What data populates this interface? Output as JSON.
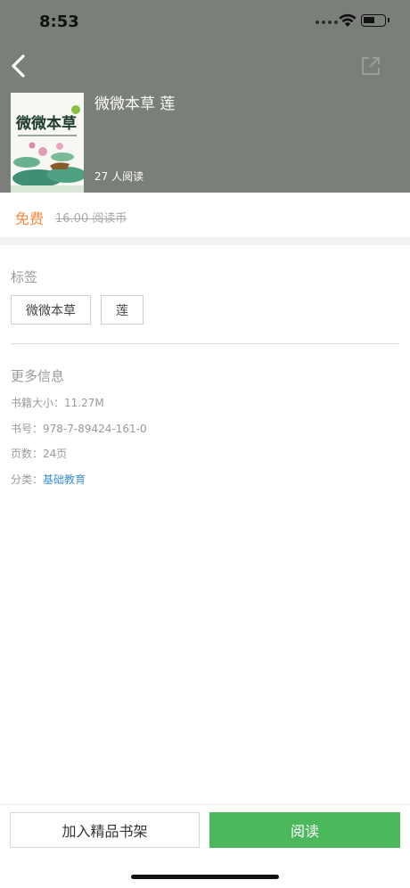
{
  "status_bar": {
    "time": "8:53"
  },
  "book": {
    "title": "微微本草 莲",
    "readers": "27 人阅读",
    "cover_title": "微微本草"
  },
  "price": {
    "free_label": "免费",
    "original": "16.00 阅读币"
  },
  "tags": {
    "heading": "标签",
    "items": [
      "微微本草",
      "莲"
    ]
  },
  "more_info": {
    "heading": "更多信息",
    "size": "书籍大小：11.27M",
    "isbn": "书号：978-7-89424-161-0",
    "pages": "页数：24页",
    "category_label": "分类：",
    "category_value": "基础教育"
  },
  "actions": {
    "add_to_shelf": "加入精品书架",
    "read": "阅读"
  },
  "colors": {
    "header_bg": "#7b7f79",
    "free_text": "#f28b3b",
    "read_button": "#4cb85c",
    "category_link": "#3b8fd9"
  }
}
